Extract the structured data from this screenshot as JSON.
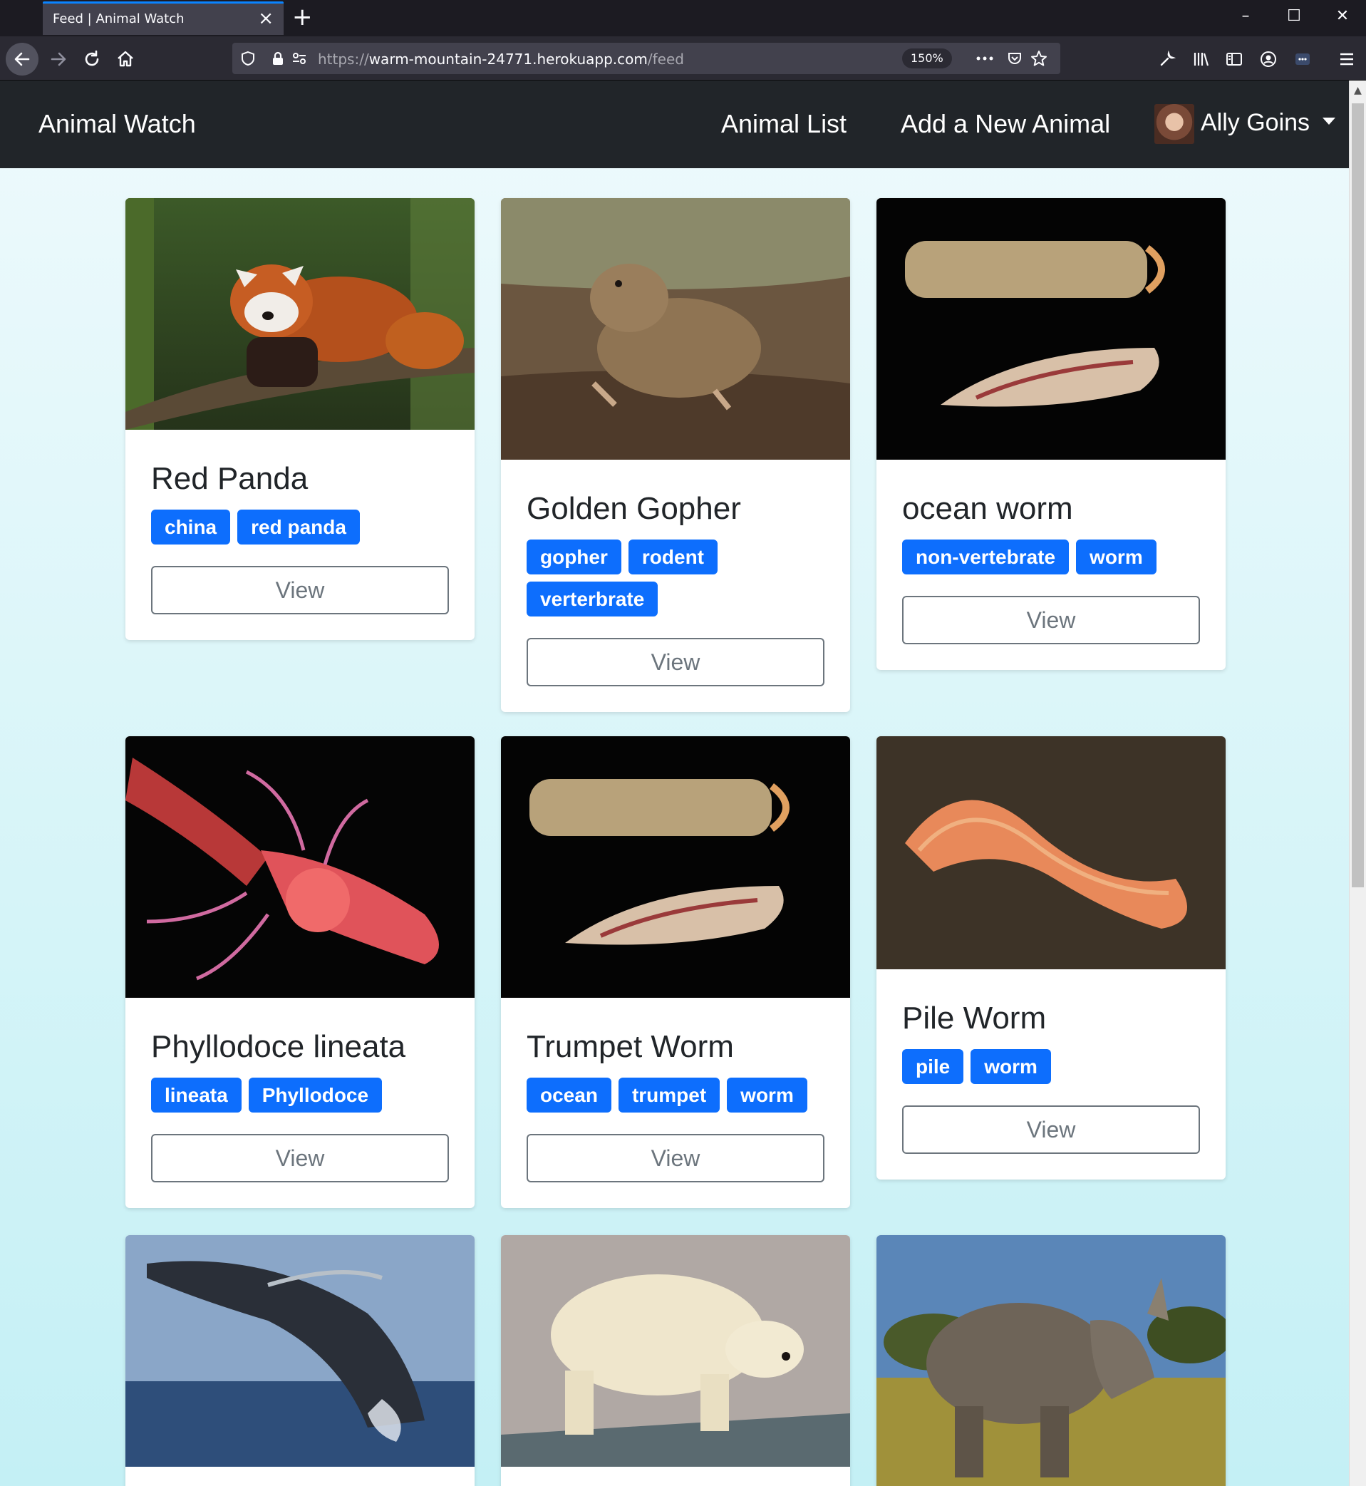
{
  "browser": {
    "tab_title": "Feed | Animal Watch",
    "url_scheme": "https://",
    "url_host": "warm-mountain-24771.herokuapp.com",
    "url_path": "/feed",
    "zoom": "150%"
  },
  "navbar": {
    "brand": "Animal Watch",
    "links": [
      "Animal List",
      "Add a New Animal"
    ],
    "user": "Ally Goins"
  },
  "view_label": "View",
  "cards": [
    {
      "title": "Red Panda",
      "tags": [
        "china",
        "red panda"
      ]
    },
    {
      "title": "Golden Gopher",
      "tags": [
        "gopher",
        "rodent",
        "verterbrate"
      ]
    },
    {
      "title": "ocean worm",
      "tags": [
        "non-vertebrate",
        "worm"
      ]
    },
    {
      "title": "Phyllodoce lineata",
      "tags": [
        "lineata",
        "Phyllodoce"
      ]
    },
    {
      "title": "Trumpet Worm",
      "tags": [
        "ocean",
        "trumpet",
        "worm"
      ]
    },
    {
      "title": "Pile Worm",
      "tags": [
        "pile",
        "worm"
      ]
    },
    {
      "title": "",
      "tags": []
    },
    {
      "title": "",
      "tags": []
    },
    {
      "title": "",
      "tags": []
    }
  ]
}
